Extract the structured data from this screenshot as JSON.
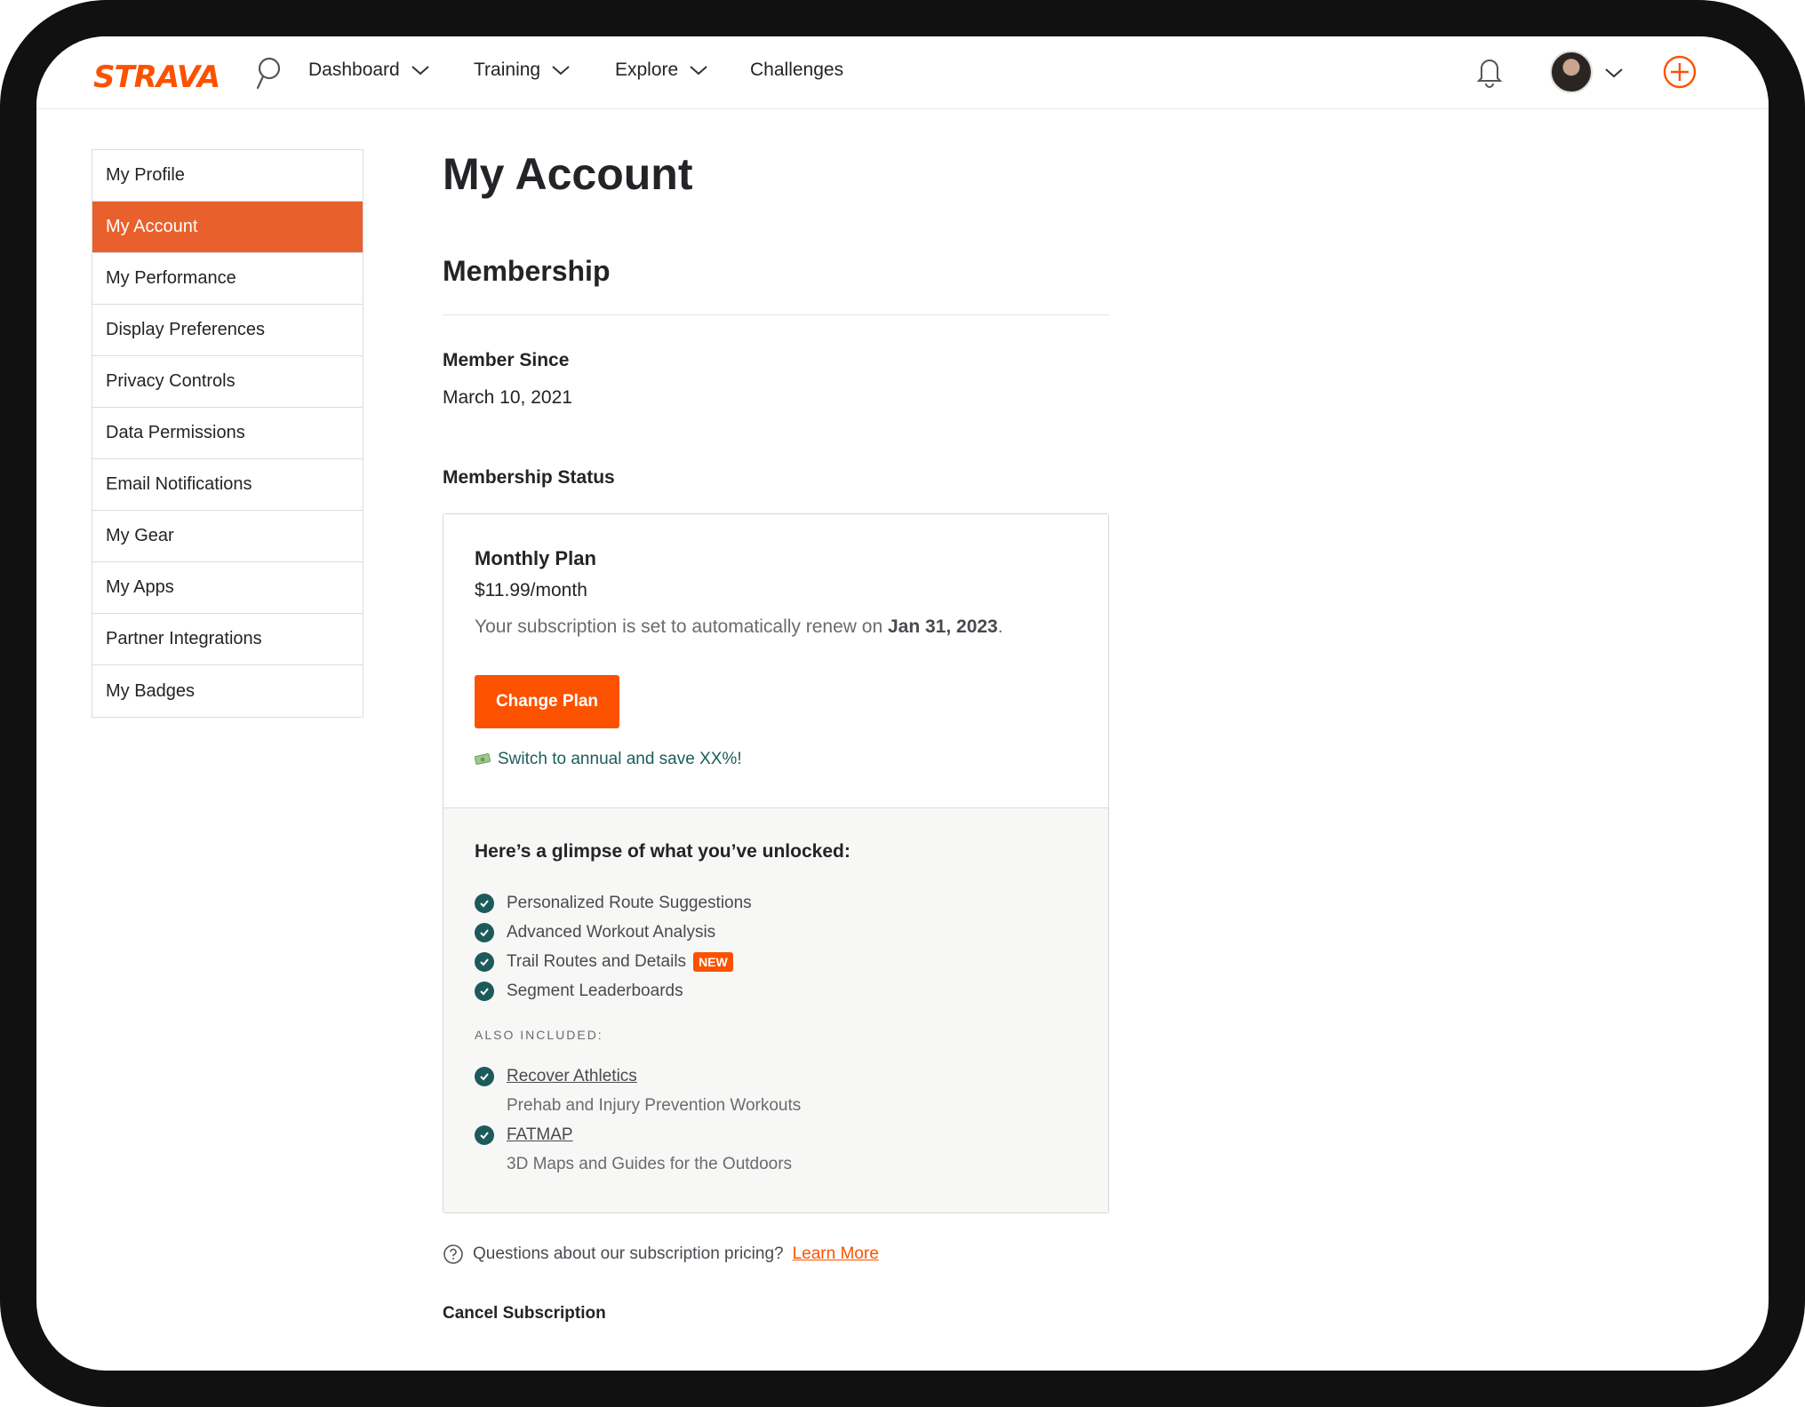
{
  "brand": {
    "logo_text": "STRAVA",
    "accent": "#fc5200"
  },
  "nav": {
    "items": [
      {
        "label": "Dashboard",
        "has_menu": true
      },
      {
        "label": "Training",
        "has_menu": true
      },
      {
        "label": "Explore",
        "has_menu": true
      },
      {
        "label": "Challenges",
        "has_menu": false
      }
    ],
    "icons": [
      "search-icon",
      "bell-icon",
      "avatar",
      "chevron-down-icon",
      "plus-circle-icon"
    ]
  },
  "sidebar": {
    "items": [
      {
        "label": "My Profile",
        "active": false
      },
      {
        "label": "My Account",
        "active": true
      },
      {
        "label": "My Performance",
        "active": false
      },
      {
        "label": "Display Preferences",
        "active": false
      },
      {
        "label": "Privacy Controls",
        "active": false
      },
      {
        "label": "Data Permissions",
        "active": false
      },
      {
        "label": "Email Notifications",
        "active": false
      },
      {
        "label": "My Gear",
        "active": false
      },
      {
        "label": "My Apps",
        "active": false
      },
      {
        "label": "Partner Integrations",
        "active": false
      },
      {
        "label": "My Badges",
        "active": false
      }
    ]
  },
  "main": {
    "title": "My Account",
    "section": "Membership",
    "member_since_label": "Member Since",
    "member_since_value": "March 10, 2021",
    "status_label": "Membership Status",
    "plan": {
      "name": "Monthly Plan",
      "price": "$11.99/month",
      "renew_text": "Your subscription is set to automatically renew on ",
      "renew_date": "Jan 31, 2023",
      "renew_suffix": ".",
      "change_button": "Change Plan",
      "promo": "Switch to annual and save XX%!"
    },
    "unlocked": {
      "heading": "Here’s a glimpse of what you’ve unlocked:",
      "features": [
        {
          "label": "Personalized Route Suggestions"
        },
        {
          "label": "Advanced Workout Analysis"
        },
        {
          "label": "Trail Routes and Details",
          "badge": "NEW"
        },
        {
          "label": "Segment Leaderboards"
        }
      ],
      "also_label": "ALSO INCLUDED:",
      "also": [
        {
          "label": "Recover Athletics",
          "desc": "Prehab and Injury Prevention Workouts"
        },
        {
          "label": "FATMAP",
          "desc": "3D Maps and Guides for the Outdoors"
        }
      ]
    },
    "help_text": "Questions about our subscription pricing?",
    "learn_more": "Learn More",
    "cancel": "Cancel Subscription"
  }
}
